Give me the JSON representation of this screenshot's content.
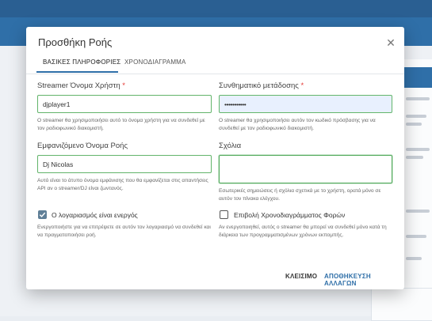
{
  "modal": {
    "title": "Προσθήκη Ροής",
    "close_icon": "close-icon"
  },
  "tabs": [
    {
      "label": "ΒΑΣΙΚΕΣ ΠΛΗΡΟΦΟΡΙΕΣ",
      "active": true
    },
    {
      "label": "ΧΡΟΝΟΔΙΑΓΡΑΜΜΑ",
      "active": false
    }
  ],
  "fields": {
    "username": {
      "label": "Streamer Όνομα Χρήστη",
      "required": "*",
      "value": "djplayer1",
      "help": "Ο streamer θα χρησιμοποιήσει αυτό το όνομα χρήστη για να συνδεθεί με τον ραδιοφωνικό διακομιστή."
    },
    "password": {
      "label": "Συνθηματικό μετάδοσης",
      "required": "*",
      "value": "•••••••••••",
      "help": "Ο streamer θα χρησιμοποιήσει αυτόν τον κωδικό πρόσβασης για να συνδεθεί με τον ραδιοφωνικό διακομιστή."
    },
    "display_name": {
      "label": "Εμφανιζόμενο Όνομα Ροής",
      "value": "Dj Nicolas",
      "help": "Αυτό είναι το άτυπο όνομα εμφάνισης που θα εμφανίζεται στις απαντήσεις API αν ο streamer/DJ είναι ζωντανός."
    },
    "comments": {
      "label": "Σχόλια",
      "value": "",
      "help": "Εσωτερικές σημειώσεις ή σχόλια σχετικά με το χρήστη, ορατά μόνο σε αυτόν τον πίνακα ελέγχου."
    }
  },
  "checkboxes": {
    "active": {
      "label": "Ο λογαριασμός είναι ενεργός",
      "checked": true,
      "help": "Ενεργοποιήστε για να επιτρέψετε σε αυτόν τον λογαριασμό να συνδεθεί και να πραγματοποιήσει ροή."
    },
    "schedule": {
      "label": "Επιβολή Χρονοδιαγράμματος Φορών",
      "checked": false,
      "help": "Αν ενεργοποιηθεί, αυτός ο streamer θα μπορεί να συνδεθεί μόνο κατά τη διάρκεια των προγραμματισμένων χρόνων εκπομπής."
    }
  },
  "footer": {
    "close_label": "ΚΛΕΙΣΙΜΟ",
    "save_label": "ΑΠΟΘΗΚΕΥΣΗ ΑΛΛΑΓΩΝ"
  },
  "colors": {
    "accent": "#2f6fa8",
    "valid_border": "#62b46a",
    "required": "#e53935"
  }
}
